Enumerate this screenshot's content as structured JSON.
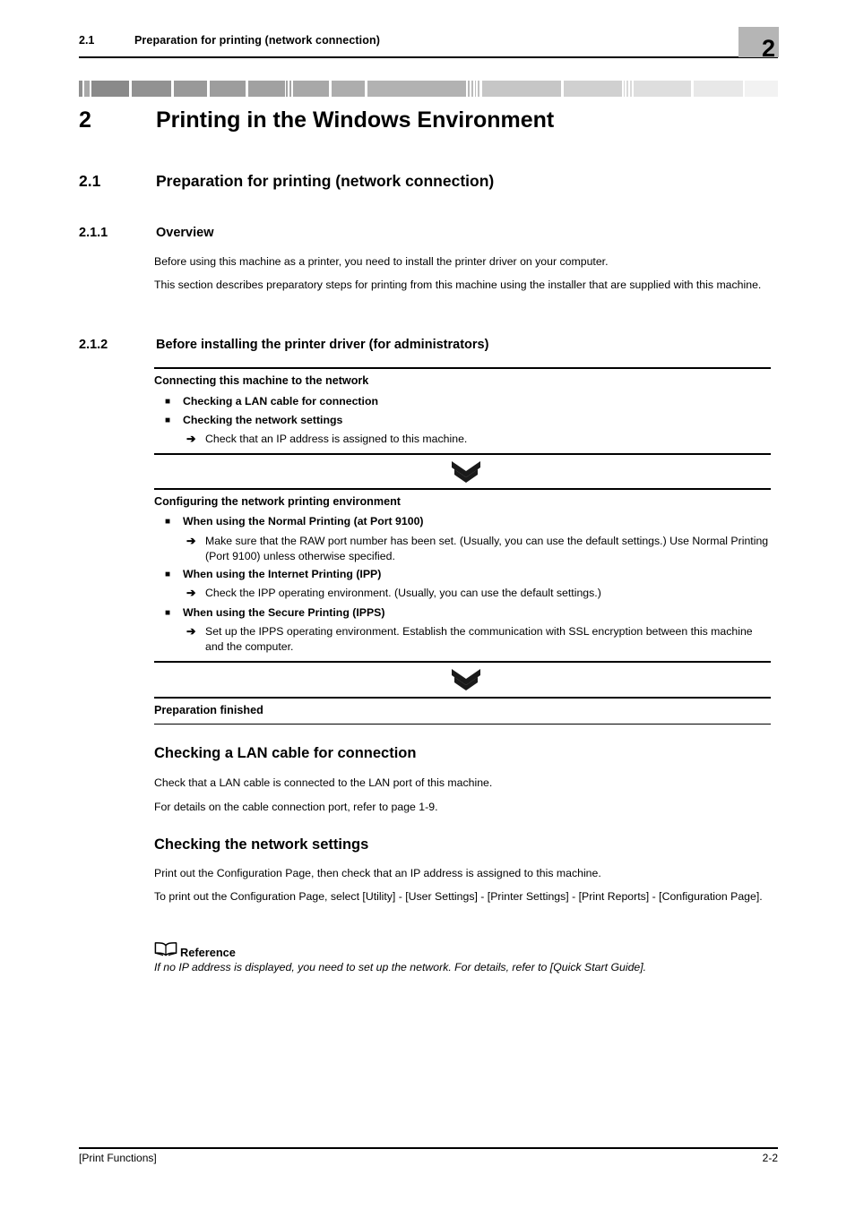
{
  "header": {
    "section_number": "2.1",
    "section_title": "Preparation for printing (network connection)",
    "chapter_number": "2"
  },
  "headings": {
    "chapter_num": "2",
    "chapter_title": "Printing in the Windows Environment",
    "h2_num": "2.1",
    "h2_title": "Preparation for printing (network connection)",
    "h3a_num": "2.1.1",
    "h3a_title": "Overview",
    "h3b_num": "2.1.2",
    "h3b_title": "Before installing the printer driver (for administrators)"
  },
  "overview": {
    "para1": "Before using this machine as a printer, you need to install the printer driver on your computer.",
    "para2": "This section describes preparatory steps for printing from this machine using the installer that are supplied with this machine."
  },
  "flow": {
    "block1": {
      "title": "Connecting this machine to the network",
      "bullets": [
        {
          "mark": "■",
          "label": "Checking a LAN cable for connection"
        },
        {
          "mark": "■",
          "label": "Checking the network settings"
        }
      ],
      "arrow1": {
        "mark": "➔",
        "text": "Check that an IP address is assigned to this machine."
      }
    },
    "chevron1_name": "double-chevron-down-icon",
    "block2": {
      "title": "Configuring the network printing environment",
      "b1": {
        "mark": "■",
        "label": "When using the Normal Printing (at Port 9100)"
      },
      "b1a": {
        "mark": "➔",
        "text": "Make sure that the RAW port number has been set. (Usually, you can use the default settings.) Use Normal Printing (Port 9100) unless otherwise specified."
      },
      "b2": {
        "mark": "■",
        "label": "When using the Internet Printing (IPP)"
      },
      "b2a": {
        "mark": "➔",
        "text": "Check the IPP operating environment. (Usually, you can use the default settings.)"
      },
      "b3": {
        "mark": "■",
        "label": "When using the Secure Printing (IPPS)"
      },
      "b3a": {
        "mark": "➔",
        "text": "Set up the IPPS operating environment. Establish the communication with SSL encryption between this machine and the computer."
      }
    },
    "chevron2_name": "double-chevron-down-icon",
    "block3": {
      "title": "Preparation finished"
    }
  },
  "lan_section": {
    "title": "Checking a LAN cable for connection",
    "para1": "Check that a LAN cable is connected to the LAN port of this machine.",
    "para2": "For details on the cable connection port, refer to page 1-9."
  },
  "network_section": {
    "title": "Checking the network settings",
    "para1": "Print out the Configuration Page, then check that an IP address is assigned to this machine.",
    "para2": "To print out the Configuration Page, select [Utility] - [User Settings] - [Printer Settings] - [Print Reports] - [Configuration Page]."
  },
  "reference": {
    "label": "Reference",
    "icon": "open-book-icon",
    "text": "If no IP address is displayed, you need to set up the network. For details, refer to [Quick Start Guide]."
  },
  "footer": {
    "left": "[Print Functions]",
    "right": "2-2"
  },
  "colors": {
    "text": "#000000",
    "chapter_box": "#b5b5b5",
    "page_bg": "#ffffff"
  }
}
